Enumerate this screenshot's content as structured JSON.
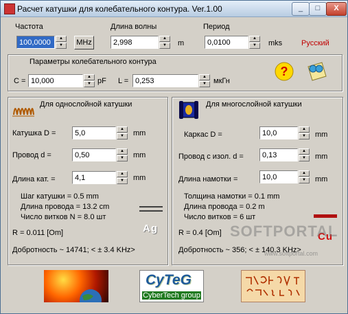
{
  "window": {
    "title": "Расчет катушки для колебательного контура. Ver.1.00"
  },
  "controls": {
    "minimize": "_",
    "maximize": "□",
    "close": "X"
  },
  "top": {
    "freq_label": "Частота",
    "freq_value": "100,0000",
    "freq_unit": "MHz",
    "wave_label": "Длина волны",
    "wave_value": "2,998",
    "wave_unit": "m",
    "period_label": "Период",
    "period_value": "0,0100",
    "period_unit": "mks",
    "language": "Русский"
  },
  "circuit": {
    "header": "Параметры колебательного контура",
    "c_label": "C =",
    "c_value": "10,000",
    "c_unit": "pF",
    "l_label": "L =",
    "l_value": "0,253",
    "l_unit": "мкГн"
  },
  "single": {
    "header": "Для однослойной катушки",
    "d_label": "Катушка D =",
    "d_value": "5,0",
    "d_unit": "mm",
    "wire_label": "Провод  d =",
    "wire_value": "0,50",
    "wire_unit": "mm",
    "len_label": "Длина кат. =",
    "len_value": "4,1",
    "len_unit": "mm",
    "res1": "Шаг  катушки =   0.5 mm",
    "res2": "Длина провода =  13.2 cm",
    "res3": "Число витков N =   8.0 шт",
    "r_text": "R =  0.011 [Om]",
    "q_text": "Добротность ~  14741; < ±  3.4 KHz>",
    "metal": "Ag"
  },
  "multi": {
    "header": "Для многослойной катушки",
    "frame_label": "Каркас   D =",
    "frame_value": "10,0",
    "frame_unit": "mm",
    "wire_label": "Провод с изол. d =",
    "wire_value": "0,13",
    "wire_unit": "mm",
    "len_label": "Длина намотки  =",
    "len_value": "10,0",
    "len_unit": "mm",
    "res1": "Толщина намотки =   0.1 mm",
    "res2": "Длина провода =   0.2 m",
    "res3": "Число витков =      6 шт",
    "r_text": "R =   0.4 [Om]",
    "q_text": "Добротность ~      356; < ±  140.3 KHz>",
    "metal": "Cu"
  },
  "logos": {
    "cyteg_big": "CyTeG",
    "cyteg_small": "CyberTech group"
  },
  "watermark": {
    "text": "SOFTPORTAL",
    "url": "www.softportal.com"
  }
}
